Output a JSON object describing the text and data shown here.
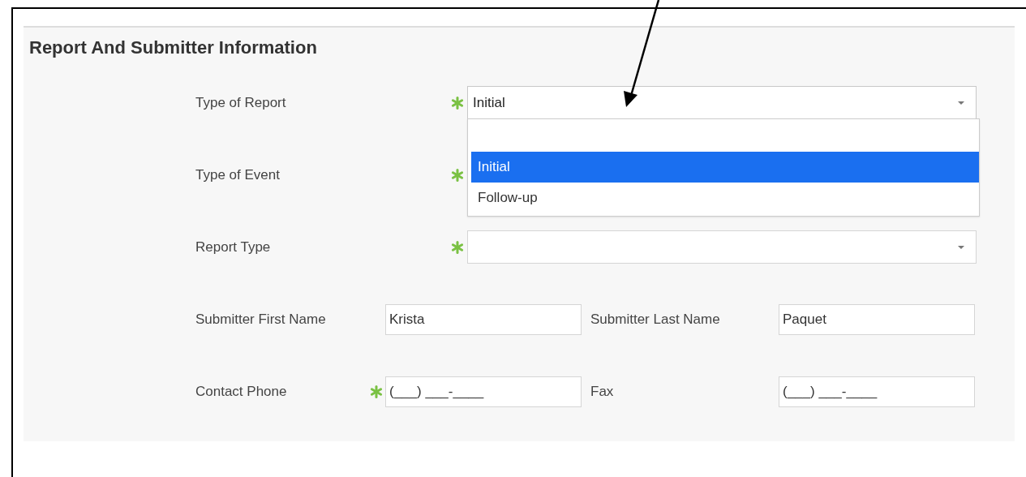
{
  "section": {
    "title": "Report And Submitter Information"
  },
  "rows": [
    {
      "fields": [
        {
          "label": "Type of Report",
          "required": true,
          "kind": "select",
          "value": "Initial",
          "dropdown": {
            "options": [
              {
                "label": "Initial",
                "selected": true
              },
              {
                "label": "Follow-up",
                "selected": false
              }
            ]
          }
        }
      ]
    },
    {
      "fields": [
        {
          "label": "Type of Event",
          "required": true
        }
      ]
    },
    {
      "fields": [
        {
          "label": "Report Type",
          "required": true,
          "kind": "select"
        }
      ]
    },
    {
      "fields": [
        {
          "label": "Submitter First Name",
          "required": false,
          "kind": "text",
          "value": "Krista"
        },
        {
          "label": "Submitter Last Name",
          "required": false,
          "kind": "text",
          "value": "Paquet"
        }
      ]
    },
    {
      "fields": [
        {
          "label": "Contact Phone",
          "required": true,
          "kind": "text",
          "value": "(___) ___-____"
        },
        {
          "label": "Fax",
          "required": false,
          "kind": "text",
          "value": "(___) ___-____"
        }
      ]
    }
  ],
  "annotation": {
    "kind": "arrow"
  }
}
